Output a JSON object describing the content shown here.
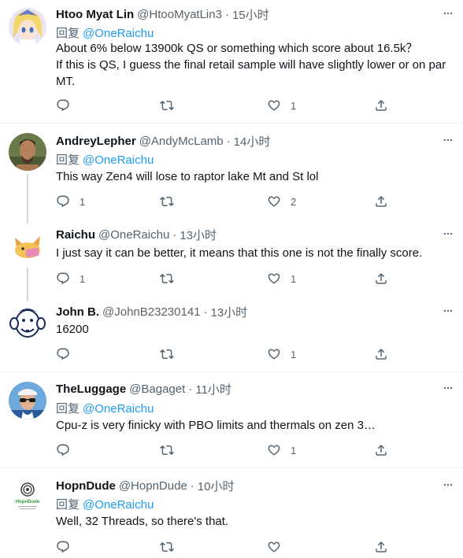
{
  "reply_prefix": "回复",
  "tweets": [
    {
      "name": "Htoo Myat Lin",
      "handle": "@HtooMyatLin3",
      "time": "15小时",
      "reply_to": "@OneRaichu",
      "text": "About 6% below 13900k QS or something which score about 16.5k？",
      "text2": "If this is QS, I guess the final retail sample will have slightly lower or on par MT.",
      "replies": "",
      "retweets": "",
      "likes": "1"
    },
    {
      "name": "AndreyLepher",
      "handle": "@AndyMcLamb",
      "time": "14小时",
      "reply_to": "@OneRaichu",
      "text": "This way Zen4 will lose to raptor lake Mt and St lol",
      "replies": "1",
      "retweets": "",
      "likes": "2"
    },
    {
      "name": "Raichu",
      "handle": "@OneRaichu",
      "time": "13小时",
      "text": "I just say it can be better, it means that this one is not the finally score.",
      "replies": "1",
      "retweets": "",
      "likes": "1"
    },
    {
      "name": "John B.",
      "handle": "@JohnB23230141",
      "time": "13小时",
      "text": "16200",
      "replies": "",
      "retweets": "",
      "likes": "1"
    },
    {
      "name": "TheLuggage",
      "handle": "@Bagaget",
      "time": "11小时",
      "reply_to": "@OneRaichu",
      "text": "Cpu-z is very finicky with PBO limits and thermals on zen 3…",
      "replies": "",
      "retweets": "",
      "likes": "1"
    },
    {
      "name": "HopnDude",
      "handle": "@HopnDude",
      "time": "10小时",
      "reply_to": "@OneRaichu",
      "text": "Well, 32 Threads, so there's that.",
      "avatar_logo": "HopnDude",
      "replies": "",
      "retweets": "",
      "likes": ""
    }
  ],
  "colors": {
    "text": "#0f1419",
    "secondary": "#536471",
    "link": "#1d9bf0",
    "divider": "#eff3f4",
    "thread_line": "#cfd9de"
  },
  "icons": [
    "more-icon",
    "reply-icon",
    "retweet-icon",
    "like-icon",
    "share-icon"
  ]
}
